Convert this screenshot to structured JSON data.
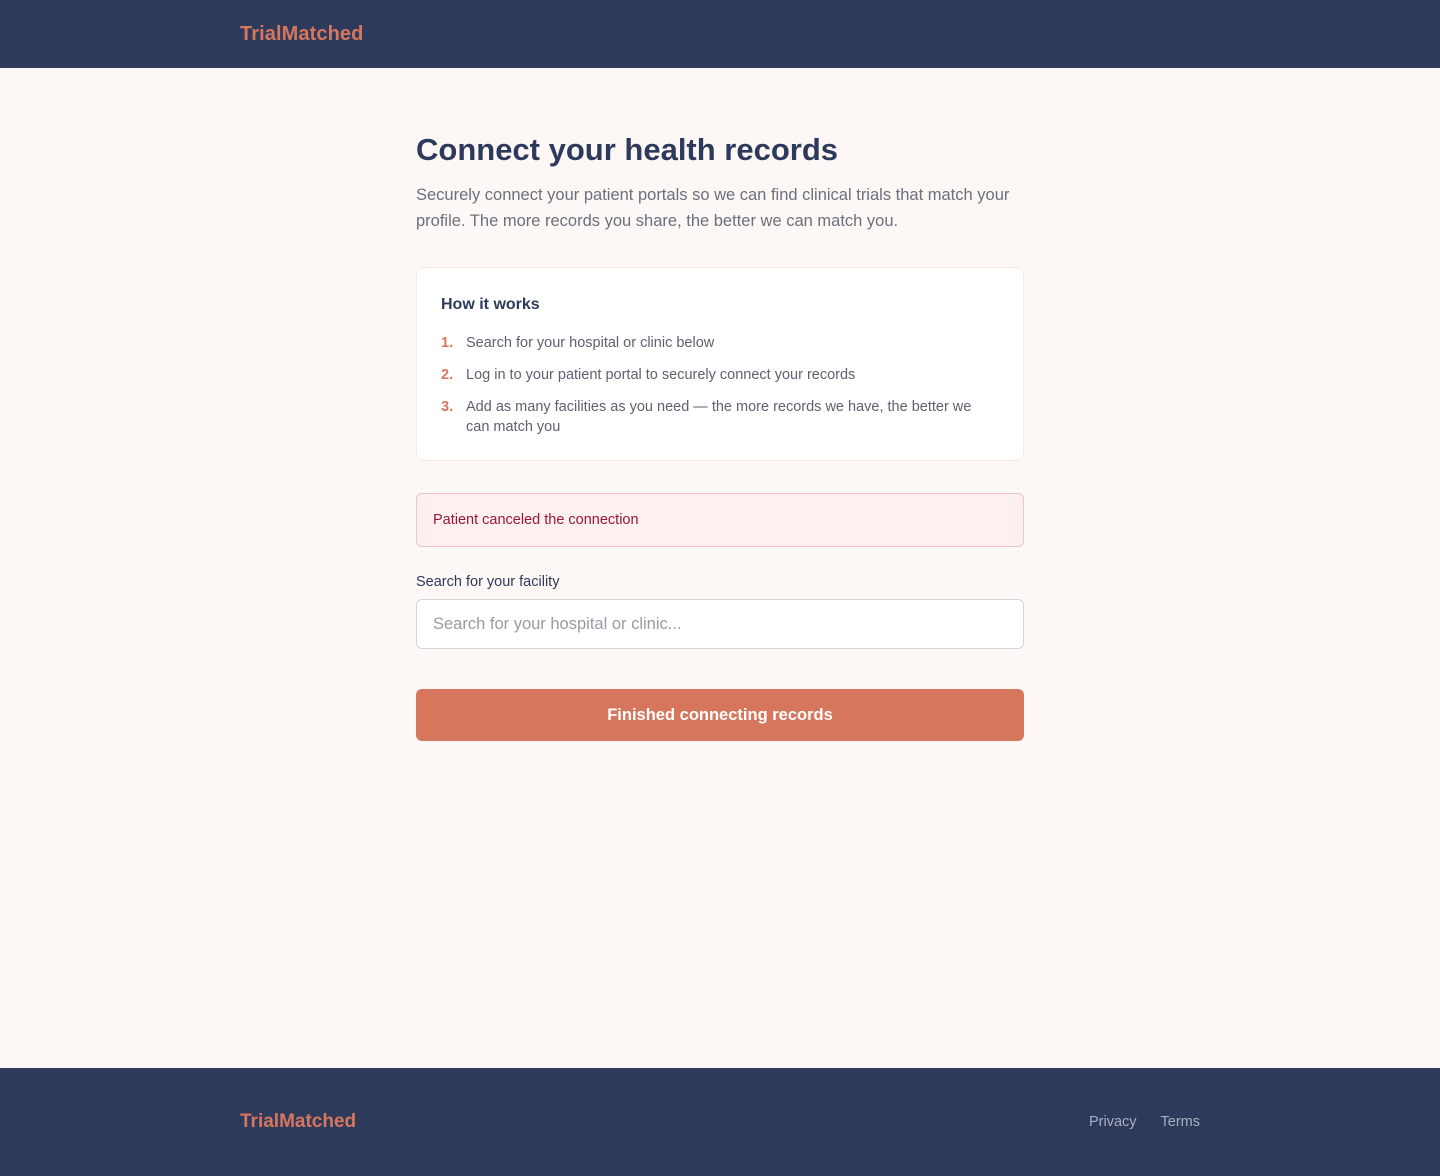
{
  "header": {
    "brand": "TrialMatched"
  },
  "main": {
    "title": "Connect your health records",
    "subtitle": "Securely connect your patient portals so we can find clinical trials that match your profile. The more records you share, the better we can match you.",
    "how_it_works": {
      "title": "How it works",
      "steps": [
        {
          "num": "1.",
          "text": "Search for your hospital or clinic below"
        },
        {
          "num": "2.",
          "text": "Log in to your patient portal to securely connect your records"
        },
        {
          "num": "3.",
          "text": "Add as many facilities as you need — the more records we have, the better we can match you"
        }
      ]
    },
    "alert": {
      "message": "Patient canceled the connection"
    },
    "search": {
      "label": "Search for your facility",
      "placeholder": "Search for your hospital or clinic...",
      "value": ""
    },
    "finish_button": "Finished connecting records"
  },
  "footer": {
    "brand": "TrialMatched",
    "links": [
      "Privacy",
      "Terms"
    ]
  },
  "colors": {
    "navy": "#2e3a5b",
    "accent": "#d6775d",
    "background": "#fdf8f5",
    "alert_text": "#9a1833",
    "alert_bg": "#fdf0f1",
    "alert_border": "#f6c3cb"
  }
}
